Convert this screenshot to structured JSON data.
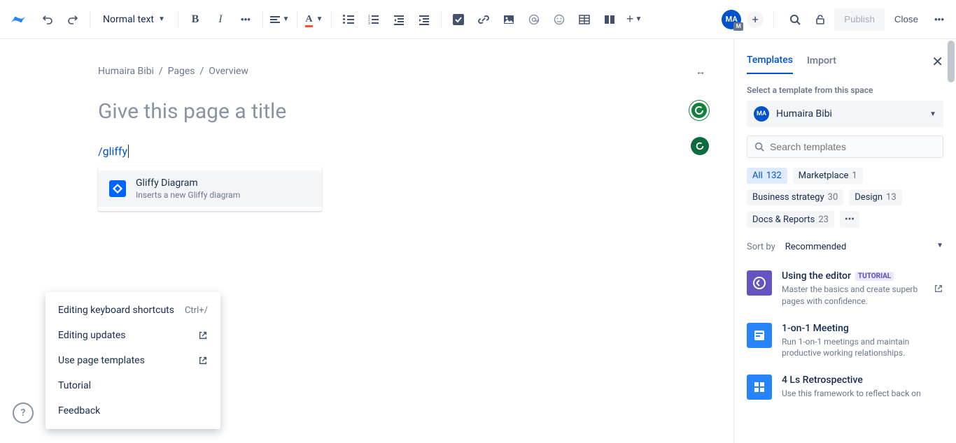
{
  "toolbar": {
    "text_style": "Normal text",
    "publish": "Publish",
    "close": "Close"
  },
  "breadcrumb": [
    "Humaira Bibi",
    "Pages",
    "Overview"
  ],
  "page": {
    "title_placeholder": "Give this page a title",
    "slash_command": "/gliffy"
  },
  "autocomplete": {
    "title": "Gliffy Diagram",
    "desc": "Inserts a new Gliffy diagram"
  },
  "help_menu": {
    "items": [
      {
        "label": "Editing keyboard shortcuts",
        "shortcut": "Ctrl+/"
      },
      {
        "label": "Editing updates",
        "icon": "open-external"
      },
      {
        "label": "Use page templates",
        "icon": "open-external"
      },
      {
        "label": "Tutorial"
      },
      {
        "label": "Feedback"
      }
    ]
  },
  "avatar": {
    "initials": "MA",
    "badge": "M"
  },
  "sidebar": {
    "tabs": [
      "Templates",
      "Import"
    ],
    "active_tab": "Templates",
    "section_label": "Select a template from this space",
    "space": {
      "initials": "MA",
      "name": "Humaira Bibi"
    },
    "search_placeholder": "Search templates",
    "categories": [
      {
        "label": "All",
        "count": 132,
        "active": true
      },
      {
        "label": "Marketplace",
        "count": 1
      },
      {
        "label": "Business strategy",
        "count": 30
      },
      {
        "label": "Design",
        "count": 13
      },
      {
        "label": "Docs & Reports",
        "count": 23
      }
    ],
    "sort_label": "Sort by",
    "sort_value": "Recommended",
    "templates": [
      {
        "title": "Using the editor",
        "badge": "TUTORIAL",
        "desc": "Master the basics and create superb pages with confidence.",
        "color": "#6554C0",
        "open_icon": true
      },
      {
        "title": "1-on-1 Meeting",
        "desc": "Run 1-on-1 meetings and maintain productive working relationships.",
        "color": "#2684FF"
      },
      {
        "title": "4 Ls Retrospective",
        "desc": "Use this framework to reflect back on",
        "color": "#2684FF"
      }
    ]
  }
}
